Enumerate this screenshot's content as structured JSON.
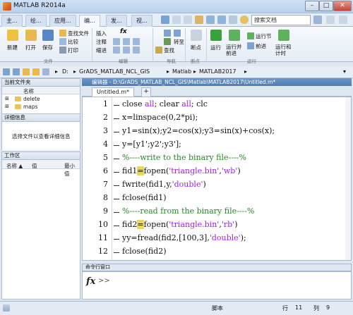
{
  "window": {
    "title": "MATLAB R2014a",
    "min": "–",
    "max": "□",
    "close": "✕"
  },
  "tabs": [
    "主...",
    "绘...",
    "应用...",
    "编...",
    "发...",
    "视..."
  ],
  "search": {
    "placeholder": "搜索文档"
  },
  "ribbon": {
    "file": {
      "new": "新建",
      "open": "打开",
      "save": "保存",
      "find_file": "查找文件",
      "compare": "比较",
      "print": "打印",
      "group": "文件"
    },
    "edit": {
      "insert": "插入",
      "comment": "注释",
      "indent": "缩进",
      "fx": "fx",
      "group": "编辑"
    },
    "navigate": {
      "goto": "转至",
      "find": "查找",
      "group": "导航"
    },
    "breakpoints": {
      "label": "断点",
      "group": "断点"
    },
    "run": {
      "run": "运行",
      "run_advance": "运行并\n前进",
      "run_section": "运行节",
      "advance": "前进",
      "run_time": "运行和\n计时",
      "group": "运行"
    }
  },
  "address": {
    "items": [
      "D:",
      "GrADS_MATLAB_NCL_GIS",
      "Matlab",
      "MATLAB2017"
    ]
  },
  "current_folder": {
    "title": "当前文件夹",
    "column_name": "名称",
    "items": [
      "delete",
      "maps"
    ]
  },
  "details": {
    "title": "详细信息",
    "message": "选择文件以查看详细信息"
  },
  "workspace": {
    "title": "工作区",
    "col_name": "名称 ▲",
    "col_value": "值",
    "col_min": "最小值"
  },
  "editor": {
    "title": "编辑器 - D:\\GrADS_MATLAB_NCL_GIS\\Matlab\\MATLAB2017\\Untitled.m*",
    "tab": "Untitled.m*",
    "add_tab": "+",
    "lines": [
      {
        "n": "1",
        "parts": [
          {
            "t": "close ",
            "c": "kw"
          },
          {
            "t": "all",
            "c": "str"
          },
          {
            "t": "; clear ",
            "c": "kw"
          },
          {
            "t": "all",
            "c": "str"
          },
          {
            "t": "; clc",
            "c": "kw"
          }
        ]
      },
      {
        "n": "2",
        "parts": [
          {
            "t": "x=linspace(0,2*pi);",
            "c": "kw"
          }
        ]
      },
      {
        "n": "3",
        "parts": [
          {
            "t": "y1=sin(x);y2=cos(x);y3=sin(x)+cos(x);",
            "c": "kw"
          }
        ]
      },
      {
        "n": "4",
        "parts": [
          {
            "t": "y=[y1';y2';y3'];",
            "c": "kw"
          }
        ]
      },
      {
        "n": "5",
        "parts": [
          {
            "t": "%----write to the binary file----%",
            "c": "cm"
          }
        ]
      },
      {
        "n": "6",
        "parts": [
          {
            "t": "fid1",
            "c": "kw"
          },
          {
            "t": "=",
            "c": "hl"
          },
          {
            "t": "fopen(",
            "c": "kw"
          },
          {
            "t": "'triangle.bin'",
            "c": "str"
          },
          {
            "t": ",",
            "c": "kw"
          },
          {
            "t": "'wb'",
            "c": "str"
          },
          {
            "t": ")",
            "c": "kw"
          }
        ]
      },
      {
        "n": "7",
        "parts": [
          {
            "t": "fwrite(fid1,y,",
            "c": "kw"
          },
          {
            "t": "'double'",
            "c": "str"
          },
          {
            "t": ")",
            "c": "kw"
          }
        ]
      },
      {
        "n": "8",
        "parts": [
          {
            "t": "fclose(fid1)",
            "c": "kw"
          }
        ]
      },
      {
        "n": "9",
        "parts": [
          {
            "t": "%----read from the binary file----%",
            "c": "cm"
          }
        ]
      },
      {
        "n": "10",
        "parts": [
          {
            "t": "fid2",
            "c": "kw"
          },
          {
            "t": "=",
            "c": "hl"
          },
          {
            "t": "fopen(",
            "c": "kw"
          },
          {
            "t": "'triangle.bin'",
            "c": "str"
          },
          {
            "t": ",",
            "c": "kw"
          },
          {
            "t": "'rb'",
            "c": "str"
          },
          {
            "t": ")",
            "c": "kw"
          }
        ]
      },
      {
        "n": "11",
        "parts": [
          {
            "t": "yy=fread(fid2,[100,3],",
            "c": "kw"
          },
          {
            "t": "'double'",
            "c": "str"
          },
          {
            "t": ");",
            "c": "kw"
          }
        ]
      },
      {
        "n": "12",
        "parts": [
          {
            "t": "fclose(fid2)",
            "c": "kw"
          }
        ]
      }
    ]
  },
  "command_window": {
    "title": "命令行窗口",
    "fx": "fx",
    "prompt": ">>"
  },
  "status": {
    "script": "脚本",
    "row_label": "行",
    "row": "11",
    "col_label": "列",
    "col": "9"
  },
  "colors": {
    "editor_head": "#4f7cb4",
    "string": "#a020f0",
    "comment": "#228b22",
    "highlight": "#e9d46a"
  }
}
